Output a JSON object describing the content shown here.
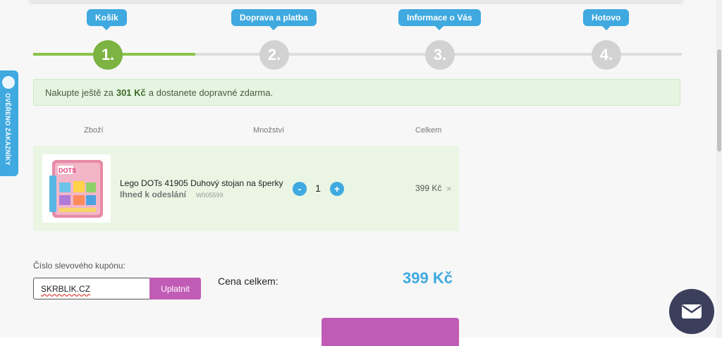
{
  "steps": [
    {
      "number": "1.",
      "label": "Košík",
      "active": true
    },
    {
      "number": "2.",
      "label": "Doprava a platba",
      "active": false
    },
    {
      "number": "3.",
      "label": "Informace o Vás",
      "active": false
    },
    {
      "number": "4.",
      "label": "Hotovo",
      "active": false
    }
  ],
  "banner": {
    "prefix": "Nakupte ještě za",
    "amount": "301 Kč",
    "suffix": "a dostanete dopravné zdarma."
  },
  "cart": {
    "headers": {
      "product": "Zboží",
      "quantity": "Množství",
      "total": "Celkem"
    },
    "item": {
      "name": "Lego DOTs 41905 Duhový stojan na šperky",
      "availability": "Ihned k odeslání",
      "sku": "W005599",
      "quantity": "1",
      "minus_label": "-",
      "plus_label": "+",
      "price": "399 Kč",
      "remove_label": "×"
    }
  },
  "coupon": {
    "label": "Číslo slevového kupónu:",
    "value": "SKRBLIK.CZ",
    "apply_label": "Uplatnit"
  },
  "summary": {
    "total_label": "Cena celkem:",
    "total_value": "399 Kč"
  },
  "side_badge": {
    "text": "OVĚŘENO ZÁKAZNÍKY"
  },
  "colors": {
    "accent_blue": "#3fa9e0",
    "active_green": "#7cb342",
    "button_purple": "#c05cb5",
    "chat_dark": "#3b3f5c"
  }
}
